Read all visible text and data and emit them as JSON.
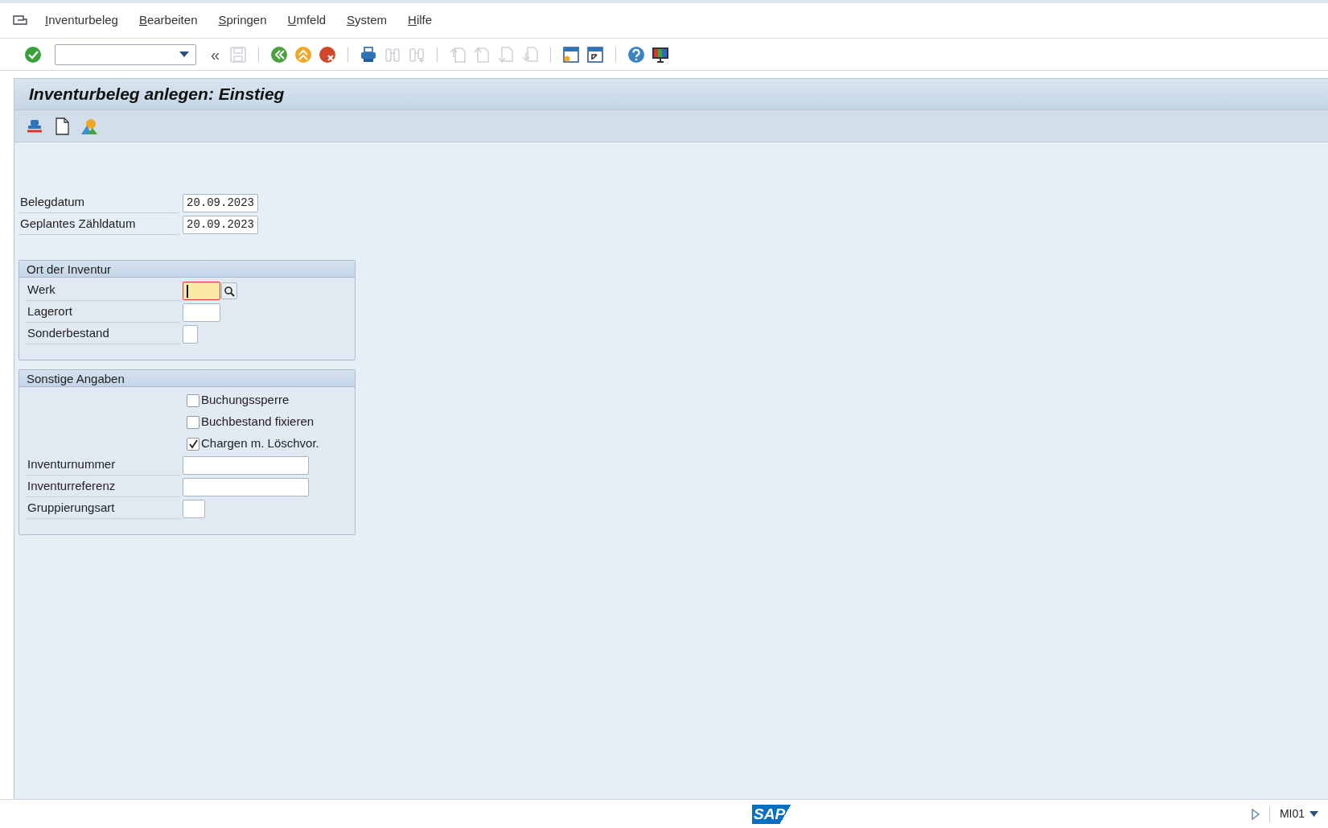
{
  "menu": [
    {
      "label": "Inventurbeleg"
    },
    {
      "label": "Bearbeiten"
    },
    {
      "label": "Springen"
    },
    {
      "label": "Umfeld"
    },
    {
      "label": "System"
    },
    {
      "label": "Hilfe"
    }
  ],
  "toolbar": [
    {
      "kind": "enter",
      "disabled": false
    },
    {
      "kind": "command_field"
    },
    {
      "kind": "glyph",
      "text": "«",
      "disabled": false
    },
    {
      "kind": "save",
      "disabled": true
    },
    {
      "kind": "separator"
    },
    {
      "kind": "back",
      "disabled": false
    },
    {
      "kind": "exit",
      "disabled": false
    },
    {
      "kind": "cancel",
      "disabled": false
    },
    {
      "kind": "separator"
    },
    {
      "kind": "print",
      "disabled": false
    },
    {
      "kind": "find",
      "disabled": true
    },
    {
      "kind": "find_next",
      "disabled": true
    },
    {
      "kind": "separator"
    },
    {
      "kind": "first_page",
      "disabled": true
    },
    {
      "kind": "prev_page",
      "disabled": true
    },
    {
      "kind": "next_page",
      "disabled": true
    },
    {
      "kind": "last_page",
      "disabled": true
    },
    {
      "kind": "separator"
    },
    {
      "kind": "new_session",
      "disabled": false
    },
    {
      "kind": "shortcut",
      "disabled": false
    },
    {
      "kind": "separator"
    },
    {
      "kind": "help",
      "disabled": false
    },
    {
      "kind": "layout",
      "disabled": false
    }
  ],
  "title": "Inventurbeleg anlegen: Einstieg",
  "app_toolbar": [
    {
      "kind": "stamp"
    },
    {
      "kind": "document"
    },
    {
      "kind": "landscape"
    }
  ],
  "header_fields": [
    {
      "label": "Belegdatum",
      "value": "20.09.2023"
    },
    {
      "label": "Geplantes Zähldatum",
      "value": "20.09.2023"
    }
  ],
  "groups": [
    {
      "title": "Ort der Inventur",
      "rows": [
        {
          "kind": "field",
          "label": "Werk",
          "focused": true,
          "search_help": true
        },
        {
          "kind": "field",
          "label": "Lagerort",
          "focused": false,
          "search_help": false
        },
        {
          "kind": "field",
          "label": "Sonderbestand",
          "focused": false,
          "search_help": false
        }
      ]
    },
    {
      "title": "Sonstige Angaben",
      "rows": [
        {
          "kind": "checkbox",
          "label": "Buchungssperre",
          "checked": false
        },
        {
          "kind": "checkbox",
          "label": "Buchbestand fixieren",
          "checked": false
        },
        {
          "kind": "checkbox",
          "label": "Chargen m. Löschvor.",
          "checked": true
        },
        {
          "kind": "field",
          "label": "Inventurnummer",
          "focused": false,
          "search_help": false
        },
        {
          "kind": "field",
          "label": "Inventurreferenz",
          "focused": false,
          "search_help": false
        },
        {
          "kind": "field",
          "label": "Gruppierungsart",
          "focused": false,
          "search_help": false
        }
      ]
    }
  ],
  "status_bar": {
    "logo": "SAP",
    "transaction": "MI01"
  }
}
